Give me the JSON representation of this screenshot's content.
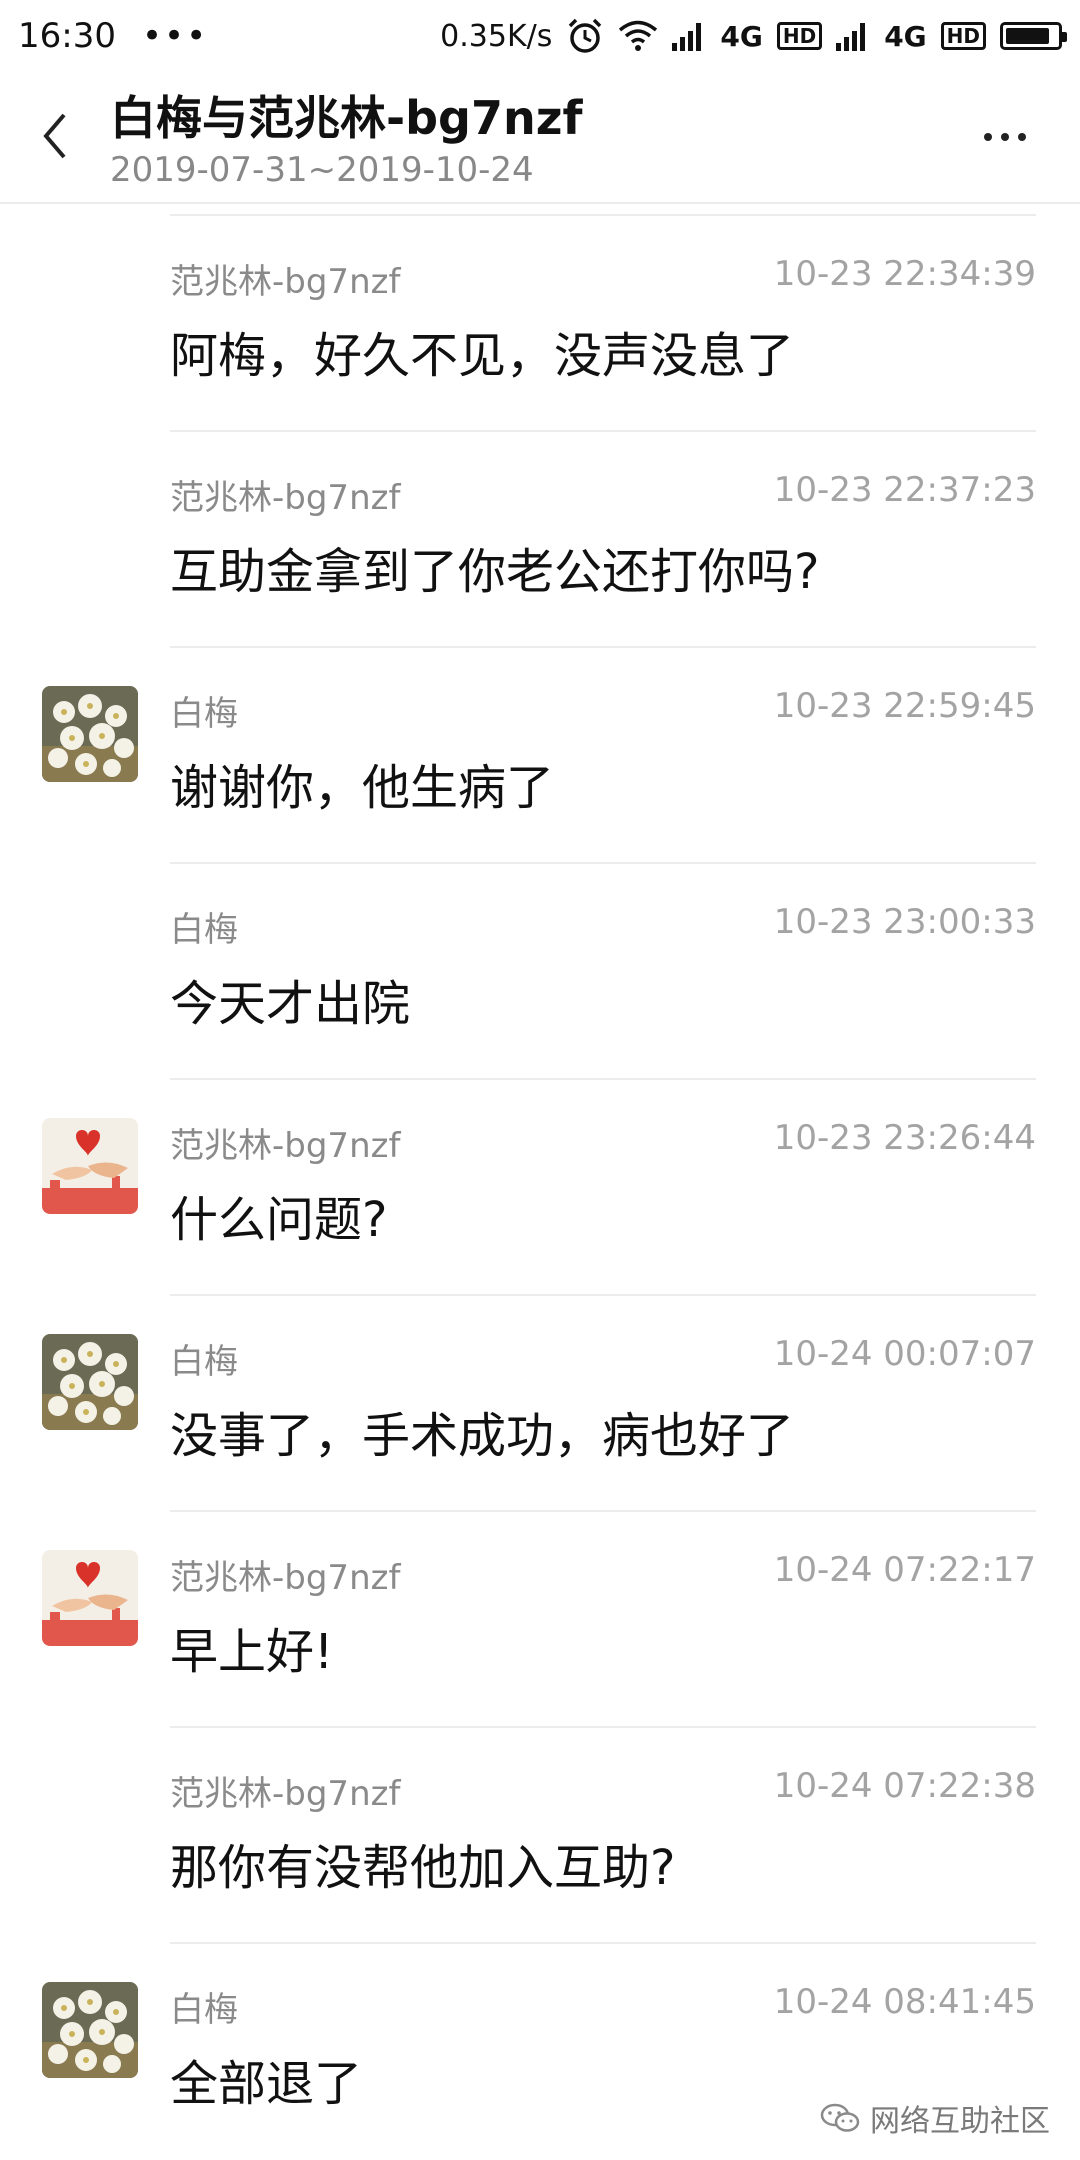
{
  "status_bar": {
    "time": "16:30",
    "dots": "•••",
    "speed": "0.35K/s",
    "network1": "4G",
    "hd1": "HD",
    "network2": "4G",
    "hd2": "HD",
    "battery_level": 0.85
  },
  "header": {
    "title": "白梅与范兆林-bg7nzf",
    "subtitle": "2019-07-31~2019-10-24"
  },
  "messages": [
    {
      "sender": "范兆林-bg7nzf",
      "time": "10-23 22:34:39",
      "text": "阿梅，好久不见，没声没息了",
      "avatar": ""
    },
    {
      "sender": "范兆林-bg7nzf",
      "time": "10-23 22:37:23",
      "text": "互助金拿到了你老公还打你吗?",
      "avatar": ""
    },
    {
      "sender": "白梅",
      "time": "10-23 22:59:45",
      "text": "谢谢你，他生病了",
      "avatar": "flowers"
    },
    {
      "sender": "白梅",
      "time": "10-23 23:00:33",
      "text": "今天才出院",
      "avatar": ""
    },
    {
      "sender": "范兆林-bg7nzf",
      "time": "10-23 23:26:44",
      "text": "什么问题?",
      "avatar": "hands-heart"
    },
    {
      "sender": "白梅",
      "time": "10-24 00:07:07",
      "text": "没事了，手术成功，病也好了",
      "avatar": "flowers"
    },
    {
      "sender": "范兆林-bg7nzf",
      "time": "10-24 07:22:17",
      "text": "早上好!",
      "avatar": "hands-heart"
    },
    {
      "sender": "范兆林-bg7nzf",
      "time": "10-24 07:22:38",
      "text": "那你有没帮他加入互助?",
      "avatar": ""
    },
    {
      "sender": "白梅",
      "time": "10-24 08:41:45",
      "text": "全部退了",
      "avatar": "flowers"
    }
  ],
  "watermark": {
    "text": "网络互助社区"
  }
}
